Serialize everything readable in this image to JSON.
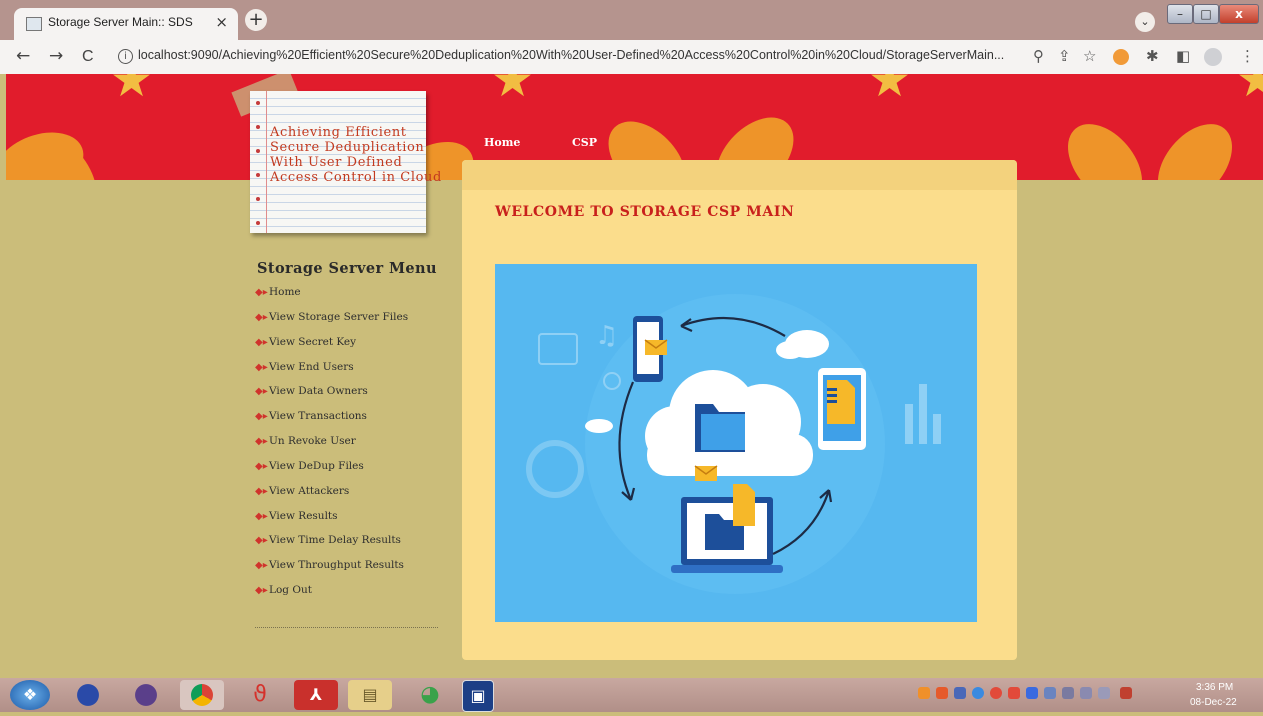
{
  "browser": {
    "tab_title": "Storage Server Main:: SDS",
    "tab_close": "×",
    "new_tab": "+",
    "tab_menu": "⌄",
    "url": "localhost:9090/Achieving%20Efficient%20Secure%20Deduplication%20With%20User-Defined%20Access%20Control%20in%20Cloud/StorageServerMain...",
    "nav": {
      "back": "←",
      "forward": "→",
      "reload": "C"
    },
    "window": {
      "minimize": "–",
      "maximize": "□",
      "close": "x"
    }
  },
  "header": {
    "notepad_title": "Achieving Efficient\nSecure Deduplication\nWith User Defined\nAccess Control in Cloud",
    "nav": [
      "Home",
      "CSP"
    ]
  },
  "sidebar": {
    "title": "Storage Server Menu",
    "items": [
      "Home",
      "View Storage Server Files",
      "View Secret Key",
      "View End Users",
      "View Data Owners",
      "View Transactions",
      "Un Revoke User",
      "View DeDup Files",
      "View Attackers",
      "View Results",
      "View Time Delay Results",
      "View Throughput Results",
      "Log Out"
    ]
  },
  "main": {
    "welcome": "WELCOME TO STORAGE CSP MAIN"
  },
  "taskbar": {
    "time": "3:36 PM",
    "date": "08-Dec-22"
  },
  "colors": {
    "banner_red": "#e11c2c",
    "page_background": "#cbbd7a",
    "content_background": "#fbdd8c",
    "welcome_text": "#c8201c",
    "illustration_blue": "#56b8f0"
  }
}
